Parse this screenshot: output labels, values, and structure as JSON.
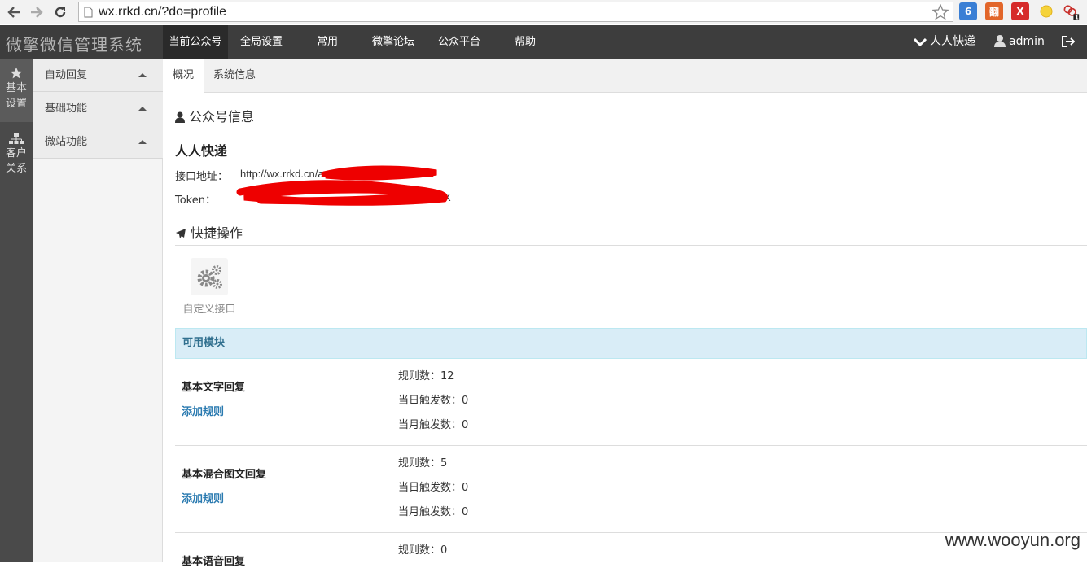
{
  "browser": {
    "url": "wx.rrkd.cn/?do=profile",
    "extensions": [
      {
        "name": "star-icon",
        "color": "#888888"
      },
      {
        "name": "6-icon",
        "glyph": "6",
        "color": "#3a7fd5"
      },
      {
        "name": "translate-icon",
        "glyph": "翻",
        "color": "#e2662a"
      },
      {
        "name": "close-ext-icon",
        "glyph": "X",
        "color": "#d62b2b"
      },
      {
        "name": "sun-icon",
        "glyph": "",
        "color": "#f3c12a"
      },
      {
        "name": "link-icon",
        "glyph": "",
        "color": "#c8312d"
      }
    ],
    "ext_badge": "1"
  },
  "topnav": {
    "brand": "微擎微信管理系统",
    "items": [
      "当前公众号",
      "全局设置",
      "常用",
      "微擎论坛",
      "公众平台",
      "帮助"
    ],
    "account_switch": "人人快递",
    "user": "admin",
    "logout": "退"
  },
  "rail": [
    {
      "label": "基本设置",
      "icon": "star-icon"
    },
    {
      "label": "客户关系",
      "icon": "sitemap-icon"
    }
  ],
  "submenu": [
    "自动回复",
    "基础功能",
    "微站功能"
  ],
  "tabs": [
    "概况",
    "系统信息"
  ],
  "profile": {
    "section_title": "公众号信息",
    "account_name": "人人快递",
    "interface_label": "接口地址：",
    "interface_value": "http://wx.rrkd.cn/a",
    "token_label": "Token：",
    "token_value": "X"
  },
  "quick_ops": {
    "section_title": "快捷操作",
    "tiles": [
      {
        "label": "自定义接口",
        "icon": "gears-icon"
      }
    ]
  },
  "modules": {
    "heading": "可用模块",
    "rows": [
      {
        "name": "基本文字回复",
        "add": "添加规则",
        "rules": "规则数：12",
        "daily": "当日触发数：0",
        "monthly": "当月触发数：0"
      },
      {
        "name": "基本混合图文回复",
        "add": "添加规则",
        "rules": "规则数：5",
        "daily": "当日触发数：0",
        "monthly": "当月触发数：0"
      },
      {
        "name": "基本语音回复",
        "add": "",
        "rules": "规则数：0",
        "daily": "",
        "monthly": ""
      }
    ]
  },
  "watermark": "www.wooyun.org",
  "colors": {
    "topnav": "#3d3d3d",
    "rail": "#4a4a4a",
    "info_header": "#d9edf7",
    "link": "#2a7ab0",
    "redaction": "#ee0000"
  }
}
